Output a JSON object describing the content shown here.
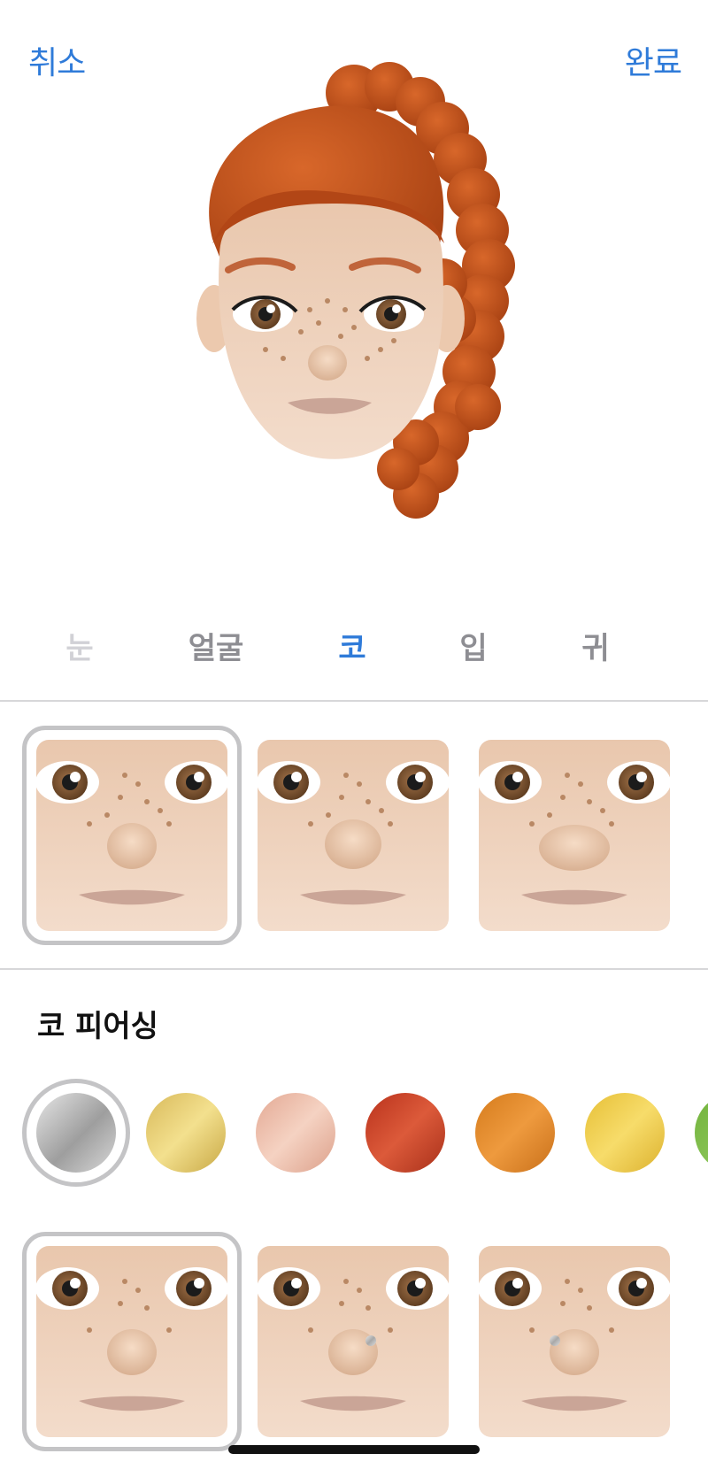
{
  "header": {
    "cancel_label": "취소",
    "done_label": "완료"
  },
  "tabs": [
    {
      "label": "눈",
      "state": "faded"
    },
    {
      "label": "얼굴",
      "state": "normal"
    },
    {
      "label": "코",
      "state": "active"
    },
    {
      "label": "입",
      "state": "normal"
    },
    {
      "label": "귀",
      "state": "normal"
    }
  ],
  "nose_options": {
    "selected_index": 0,
    "count_visible": 3
  },
  "piercing_section": {
    "title": "코 피어싱",
    "colors": [
      {
        "name": "silver",
        "hex": "#bdbdbd",
        "selected": true
      },
      {
        "name": "light-gold",
        "hex": "#e2c765"
      },
      {
        "name": "rose-gold",
        "hex": "#e8b4a0"
      },
      {
        "name": "red",
        "hex": "#c8432a"
      },
      {
        "name": "orange",
        "hex": "#e08a2a"
      },
      {
        "name": "yellow",
        "hex": "#efcc48"
      },
      {
        "name": "green",
        "hex": "#7fbf45"
      }
    ],
    "piercing_options_selected_index": 0
  },
  "colors": {
    "accent": "#2f7bd9",
    "divider": "#d7d7d9",
    "selection_ring": "#c4c4c6"
  }
}
